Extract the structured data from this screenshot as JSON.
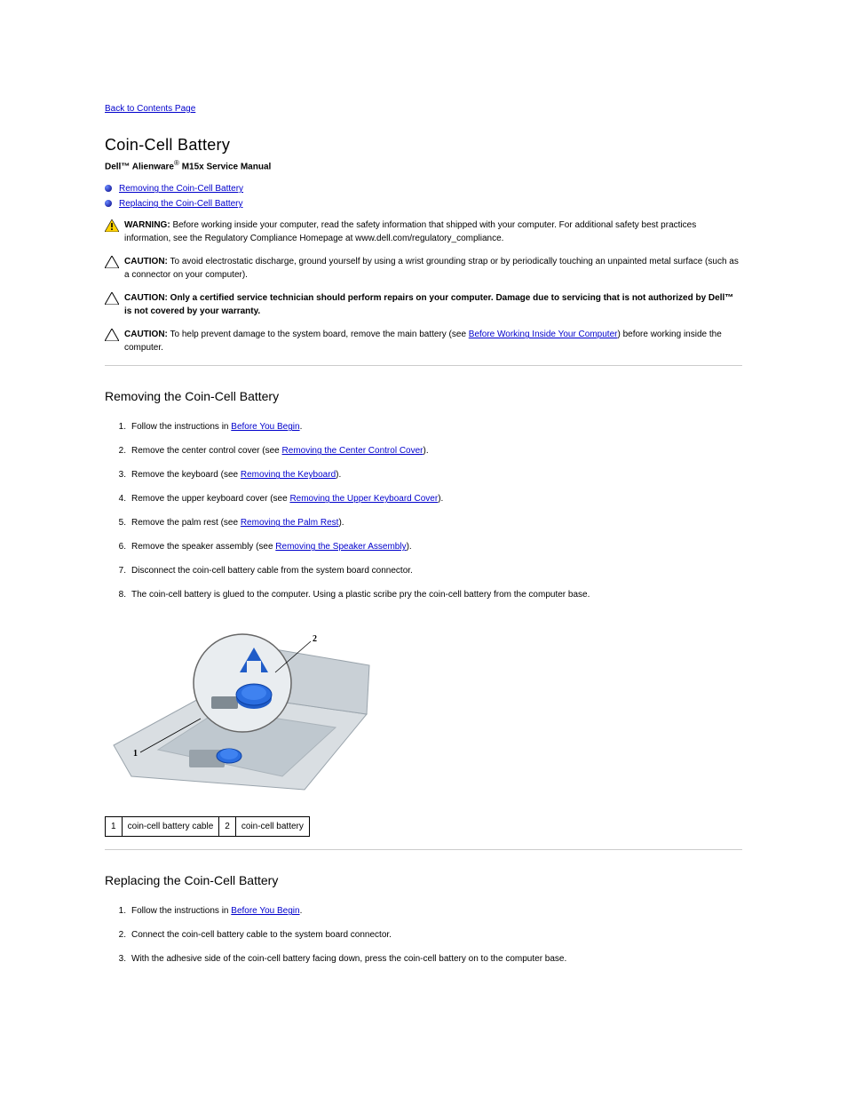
{
  "nav": {
    "back_to_contents": "Back to Contents Page"
  },
  "title": "Coin-Cell Battery",
  "manual": "Dell™ Alienware   M15x Service Manual",
  "bullets": [
    {
      "label": "Removing the Coin-Cell Battery"
    },
    {
      "label": "Replacing the Coin-Cell Battery"
    }
  ],
  "warning": {
    "label": "WARNING:",
    "text": " Before working inside your computer, read the safety information that shipped with your computer. For additional safety best practices information, see the Regulatory Compliance Homepage at www.dell.com/regulatory_compliance."
  },
  "caution1": {
    "label": "CAUTION:",
    "text": " To avoid electrostatic discharge, ground yourself by using a wrist grounding strap or by periodically touching an unpainted metal surface (such as a connector on your computer)."
  },
  "caution2": {
    "label": "CAUTION:",
    "text_pre": " Only a certified service technician should perform repairs on your computer. Damage due to servicing that is not authorized by Dell™ is not covered by your warranty."
  },
  "caution3": {
    "label": "CAUTION:",
    "text_pre": " To help prevent damage to the system board, remove the main battery (see ",
    "link": "Before Working Inside Your Computer",
    "text_post": ") before working inside the computer."
  },
  "sections": {
    "remove": {
      "heading": "Removing the Coin-Cell Battery",
      "steps": [
        {
          "n": "1.",
          "pre": "Follow the instructions in ",
          "link": "Before You Begin",
          "post": "."
        },
        {
          "n": "2.",
          "pre": "Remove the center control cover (see ",
          "link": "Removing the Center Control Cover",
          "post": ")."
        },
        {
          "n": "3.",
          "pre": "Remove the keyboard (see ",
          "link": "Removing the Keyboard",
          "post": ")."
        },
        {
          "n": "4.",
          "pre": "Remove the upper keyboard cover (see ",
          "link": "Removing the Upper Keyboard Cover",
          "post": ")."
        },
        {
          "n": "5.",
          "pre": "Remove the palm rest (see ",
          "link": "Removing the Palm Rest",
          "post": ")."
        },
        {
          "n": "6.",
          "pre": "Remove the speaker assembly (see ",
          "link": "Removing the Speaker Assembly",
          "post": ")."
        },
        {
          "n": "7.",
          "pre": "Disconnect the coin-cell battery cable from the system board connector.",
          "link": "",
          "post": ""
        },
        {
          "n": "8.",
          "pre": "The coin-cell battery is glued to the computer. Using a plastic scribe pry the coin-cell battery from the computer base.",
          "link": "",
          "post": ""
        }
      ]
    },
    "replace": {
      "heading": "Replacing the Coin-Cell Battery",
      "steps": [
        {
          "n": "1.",
          "pre": "Follow the instructions in ",
          "link": "Before You Begin",
          "post": "."
        },
        {
          "n": "2.",
          "pre": "Connect the coin-cell battery cable to the system board connector.",
          "link": "",
          "post": ""
        },
        {
          "n": "3.",
          "pre": "With the adhesive side of the coin-cell battery facing down, press the coin-cell battery on to the computer base.",
          "link": "",
          "post": ""
        }
      ]
    }
  },
  "callout": {
    "c1n": "1",
    "c1t": "coin-cell battery cable",
    "c2n": "2",
    "c2t": "coin-cell battery"
  }
}
